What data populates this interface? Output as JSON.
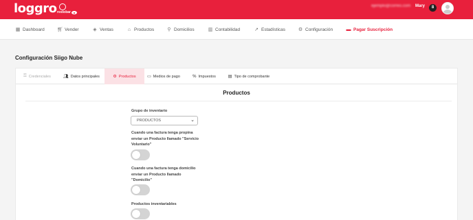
{
  "header": {
    "logo_text": "loggro",
    "logo_subtext": "restobar",
    "blurred_text": "ejemplo@correo.com",
    "user_name": "Mary",
    "user_badge": "8",
    "accent_color": "#e8203c"
  },
  "nav": {
    "items": [
      {
        "label": "Dashboard",
        "icon": "dashboard-icon"
      },
      {
        "label": "Vender",
        "icon": "cart-icon"
      },
      {
        "label": "Ventas",
        "icon": "tag-icon"
      },
      {
        "label": "Productos",
        "icon": "basket-icon"
      },
      {
        "label": "Domicilios",
        "icon": "bike-icon"
      },
      {
        "label": "Contabilidad",
        "icon": "bank-icon"
      },
      {
        "label": "Estadísticas",
        "icon": "trend-icon"
      },
      {
        "label": "Configuración",
        "icon": "gear-icon"
      },
      {
        "label": "Pagar Suscripción",
        "icon": "credit-card-icon",
        "active": true
      }
    ]
  },
  "page": {
    "title": "Configuración Siigo Nube"
  },
  "tabs": [
    {
      "label": "Credenciales",
      "icon": "key-icon",
      "state": "disabled"
    },
    {
      "label": "Datos principales",
      "icon": "users-icon",
      "state": "normal"
    },
    {
      "label": "Productos",
      "icon": "gear-icon",
      "state": "active"
    },
    {
      "label": "Medios de pago",
      "icon": "card-icon",
      "state": "normal"
    },
    {
      "label": "Impuestos",
      "icon": "percent-icon",
      "state": "normal"
    },
    {
      "label": "Tipo de comprobante",
      "icon": "document-icon",
      "state": "normal"
    }
  ],
  "section": {
    "title": "Productos"
  },
  "form": {
    "inventory_group_label": "Grupo de inventario",
    "inventory_group_value": "PRODUCTOS",
    "tip_label": "Cuando una factura tenga propina enviar un Producto llamado \"Servicio Voluntario\"",
    "tip_enabled": false,
    "delivery_label": "Cuando una factura tenga domicilio enviar un Producto llamado \"Domicilio\"",
    "delivery_enabled": false,
    "inventory_label": "Productos inventariables",
    "inventory_enabled": false
  }
}
